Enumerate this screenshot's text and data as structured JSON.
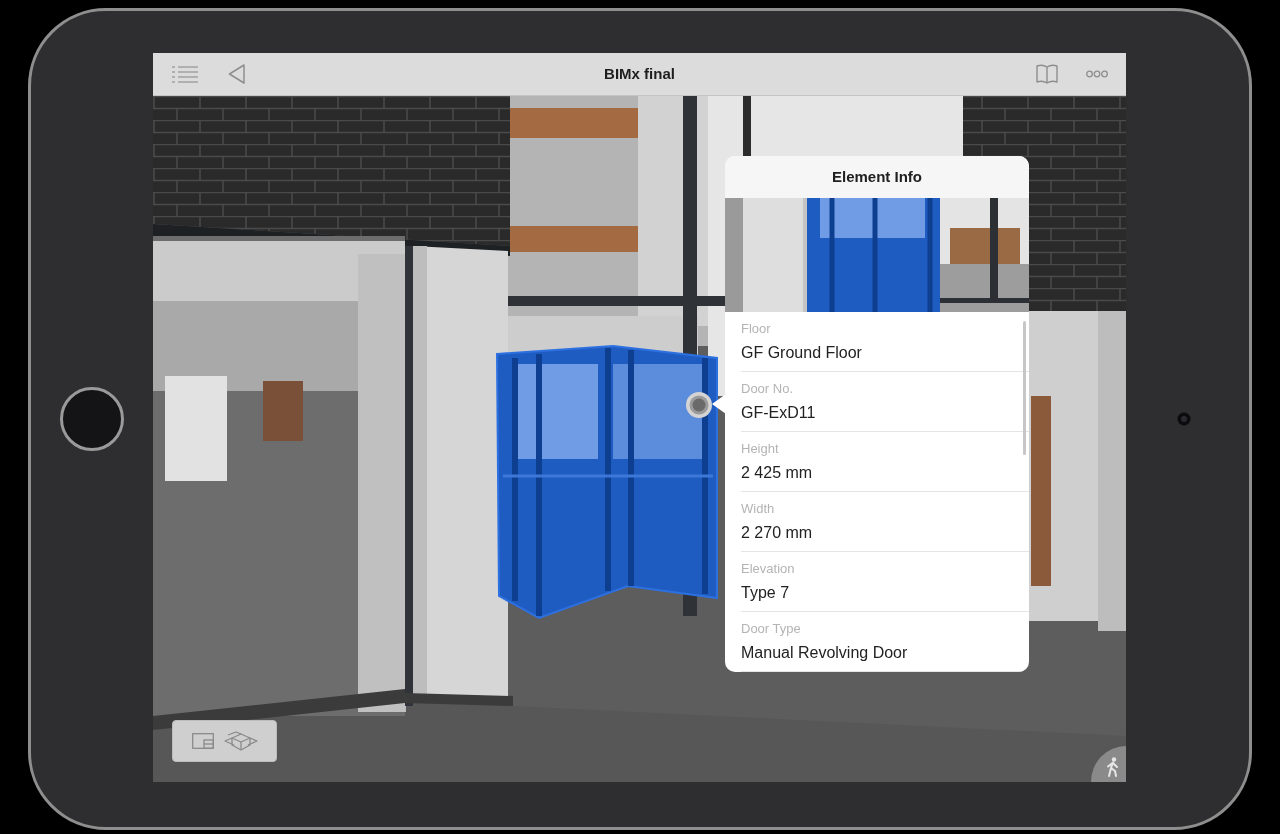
{
  "title_bar": {
    "title": "BIMx final"
  },
  "element_info": {
    "title": "Element Info",
    "properties": [
      {
        "label": "Floor",
        "value": "GF Ground Floor"
      },
      {
        "label": "Door No.",
        "value": "GF-ExD11"
      },
      {
        "label": "Height",
        "value": "2 425 mm"
      },
      {
        "label": "Width",
        "value": "2 270 mm"
      },
      {
        "label": "Elevation",
        "value": "Type 7"
      },
      {
        "label": "Door Type",
        "value": "Manual Revolving Door"
      }
    ]
  }
}
